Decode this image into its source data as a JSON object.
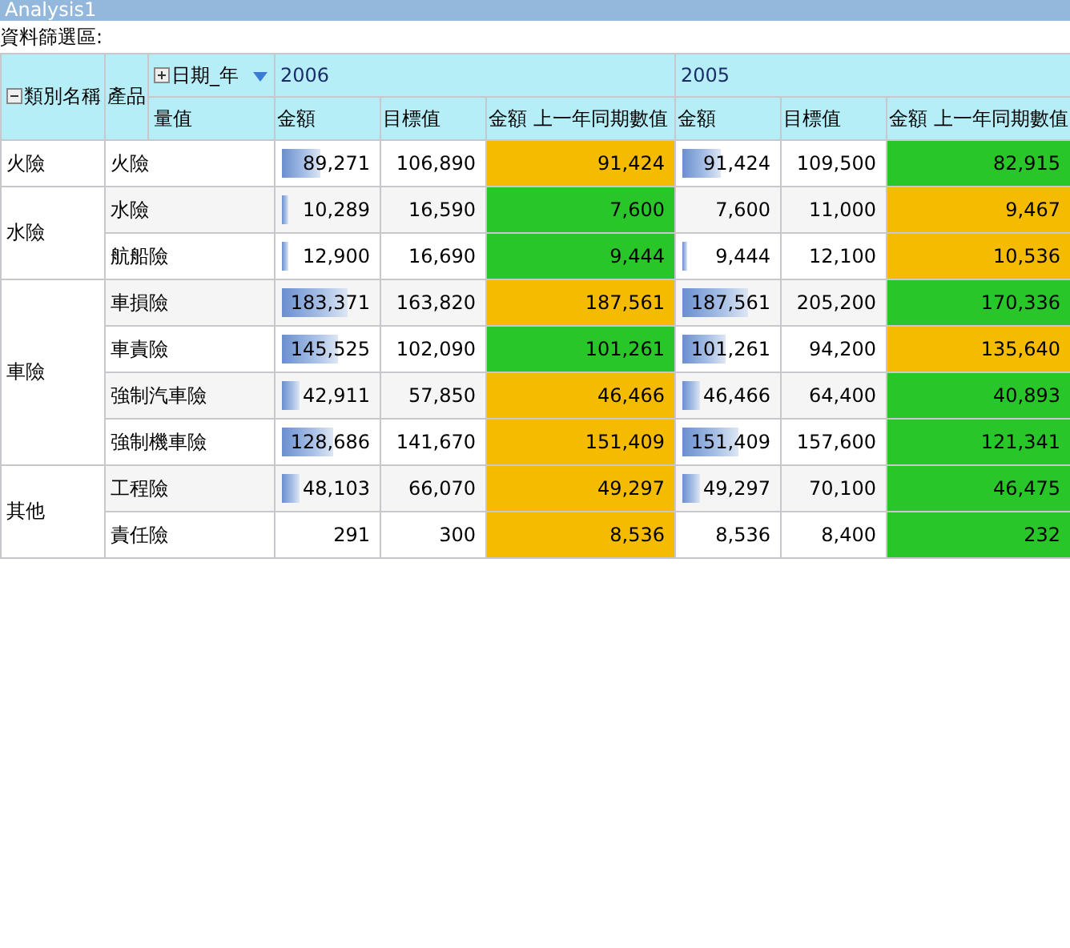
{
  "window": {
    "title": "Analysis1"
  },
  "filter_area": {
    "label": "資料篩選區:"
  },
  "pivot": {
    "row_fields": [
      {
        "label": "類別名稱",
        "expanded": true
      },
      {
        "label": "產品"
      }
    ],
    "column_field": {
      "label": "日期_年",
      "expanded": false
    },
    "measures_label": "量值",
    "years": [
      {
        "label": "2006",
        "measures": [
          "金額",
          "目標值",
          "金額 上一年同期數值"
        ]
      },
      {
        "label": "2005",
        "measures": [
          "金額",
          "目標值",
          "金額 上一年同期數值"
        ]
      }
    ],
    "categories": [
      {
        "name": "火險",
        "products": [
          {
            "name": "火險",
            "cells": [
              {
                "text": "89,271",
                "level": 0.45
              },
              {
                "text": "106,890"
              },
              {
                "text": "91,424",
                "color": "#f5bb00"
              },
              {
                "text": "91,424",
                "level": 0.45
              },
              {
                "text": "109,500"
              },
              {
                "text": "82,915",
                "color": "#28c628"
              }
            ]
          }
        ]
      },
      {
        "name": "水險",
        "products": [
          {
            "name": "水險",
            "cells": [
              {
                "text": "10,289",
                "level": 0.07
              },
              {
                "text": "16,590"
              },
              {
                "text": "7,600",
                "color": "#28c628"
              },
              {
                "text": "7,600"
              },
              {
                "text": "11,000"
              },
              {
                "text": "9,467",
                "color": "#f5bb00"
              }
            ]
          },
          {
            "name": "航船險",
            "cells": [
              {
                "text": "12,900",
                "level": 0.07
              },
              {
                "text": "16,690"
              },
              {
                "text": "9,444",
                "color": "#28c628"
              },
              {
                "text": "9,444",
                "level": 0.05
              },
              {
                "text": "12,100"
              },
              {
                "text": "10,536",
                "color": "#f5bb00"
              }
            ]
          }
        ]
      },
      {
        "name": "車險",
        "products": [
          {
            "name": "車損險",
            "cells": [
              {
                "text": "183,371",
                "level": 0.75
              },
              {
                "text": "163,820"
              },
              {
                "text": "187,561",
                "color": "#f5bb00"
              },
              {
                "text": "187,561",
                "level": 0.75
              },
              {
                "text": "205,200"
              },
              {
                "text": "170,336",
                "color": "#28c628"
              }
            ]
          },
          {
            "name": "車責險",
            "cells": [
              {
                "text": "145,525",
                "level": 0.65
              },
              {
                "text": "102,090"
              },
              {
                "text": "101,261",
                "color": "#28c628"
              },
              {
                "text": "101,261",
                "level": 0.5
              },
              {
                "text": "94,200"
              },
              {
                "text": "135,640",
                "color": "#f5bb00"
              }
            ]
          },
          {
            "name": "強制汽車險",
            "cells": [
              {
                "text": "42,911",
                "level": 0.2
              },
              {
                "text": "57,850"
              },
              {
                "text": "46,466",
                "color": "#f5bb00"
              },
              {
                "text": "46,466",
                "level": 0.2
              },
              {
                "text": "64,400"
              },
              {
                "text": "40,893",
                "color": "#28c628"
              }
            ]
          },
          {
            "name": "強制機車險",
            "cells": [
              {
                "text": "128,686",
                "level": 0.6
              },
              {
                "text": "141,670"
              },
              {
                "text": "151,409",
                "color": "#f5bb00"
              },
              {
                "text": "151,409",
                "level": 0.65
              },
              {
                "text": "157,600"
              },
              {
                "text": "121,341",
                "color": "#28c628"
              }
            ]
          }
        ]
      },
      {
        "name": "其他",
        "products": [
          {
            "name": "工程險",
            "cells": [
              {
                "text": "48,103",
                "level": 0.2
              },
              {
                "text": "66,070"
              },
              {
                "text": "49,297",
                "color": "#f5bb00"
              },
              {
                "text": "49,297",
                "level": 0.2
              },
              {
                "text": "70,100"
              },
              {
                "text": "46,475",
                "color": "#28c628"
              }
            ]
          },
          {
            "name": "責任險",
            "cells": [
              {
                "text": "291"
              },
              {
                "text": "300"
              },
              {
                "text": "8,536",
                "color": "#f5bb00"
              },
              {
                "text": "8,536"
              },
              {
                "text": "8,400"
              },
              {
                "text": "232",
                "color": "#28c628"
              }
            ]
          }
        ]
      }
    ]
  }
}
